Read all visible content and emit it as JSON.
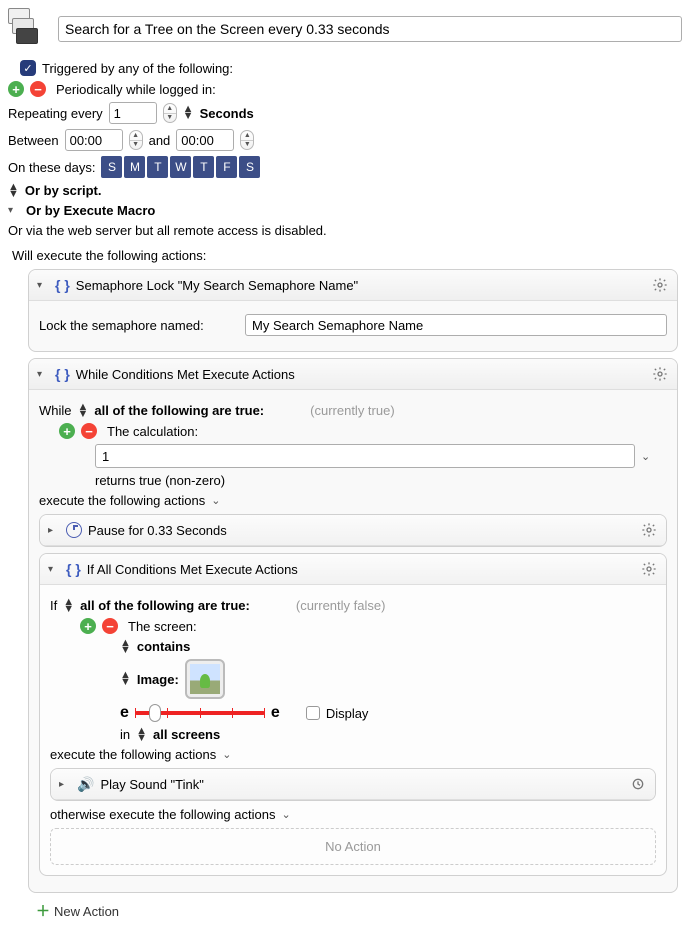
{
  "header": {
    "title": "Search for a Tree on the Screen every 0.33 seconds"
  },
  "triggers": {
    "checked_label": "Triggered by any of the following:",
    "periodic_label": "Periodically while logged in:",
    "repeat_label": "Repeating every",
    "repeat_value": "1",
    "repeat_unit": "Seconds",
    "between_label": "Between",
    "between_start": "00:00",
    "between_and": "and",
    "between_end": "00:00",
    "days_label": "On these days:",
    "days": [
      "S",
      "M",
      "T",
      "W",
      "T",
      "F",
      "S"
    ],
    "by_script": "Or by script.",
    "by_macro": "Or by Execute Macro",
    "web_server": "Or via the web server but all remote access is disabled."
  },
  "actions_intro": "Will execute the following actions:",
  "semaphore": {
    "title": "Semaphore Lock \"My Search Semaphore Name\"",
    "field_label": "Lock the semaphore named:",
    "value": "My Search Semaphore Name"
  },
  "while_block": {
    "title": "While Conditions Met Execute Actions",
    "while_word": "While",
    "condition_mode": "all of the following are true:",
    "currently": "(currently true)",
    "calc_label": "The calculation:",
    "calc_value": "1",
    "calc_result": "returns true (non-zero)",
    "execute_label": "execute the following actions"
  },
  "pause": {
    "title": "Pause for 0.33 Seconds"
  },
  "if_block": {
    "title": "If All Conditions Met Execute Actions",
    "if_word": "If",
    "condition_mode": "all of the following are true:",
    "currently": "(currently false)",
    "screen_label": "The screen:",
    "contains": "contains",
    "image_label": "Image:",
    "display_label": "Display",
    "in_label": "in",
    "in_scope": "all screens",
    "execute_label": "execute the following actions",
    "otherwise_label": "otherwise execute the following actions",
    "no_action": "No Action"
  },
  "sound": {
    "title": "Play Sound \"Tink\""
  },
  "footer": {
    "new_action": "New Action"
  },
  "fuzz_e": "e"
}
